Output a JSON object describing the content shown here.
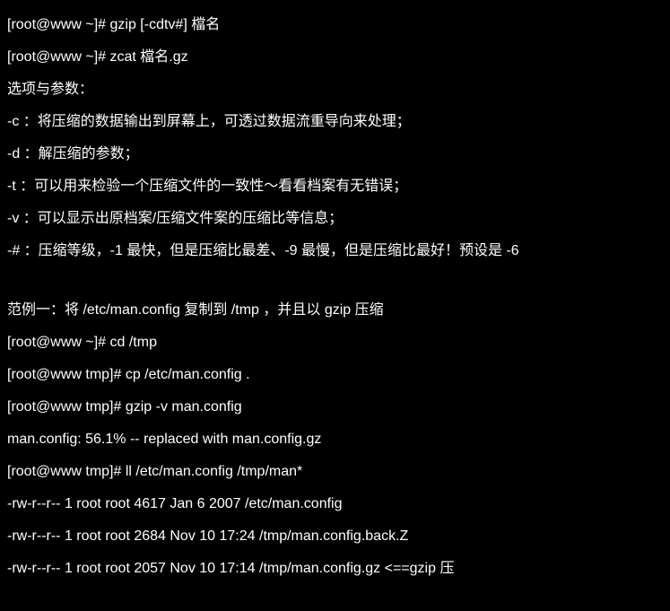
{
  "lines": [
    "[root@www ~]# gzip [-cdtv#] 檔名",
    "[root@www ~]# zcat 檔名.gz",
    "选项与参数：",
    "-c  ：将压缩的数据输出到屏幕上，可透过数据流重导向来处理；",
    "-d  ：解压缩的参数；",
    "-t  ：可以用来检验一个压缩文件的一致性～看看档案有无错误；",
    "-v  ：可以显示出原档案/压缩文件案的压缩比等信息；",
    "-#  ：压缩等级，-1 最快，但是压缩比最差、-9 最慢，但是压缩比最好！预设是 -6",
    "",
    "范例一：将 /etc/man.config 复制到 /tmp ，并且以 gzip 压缩",
    "[root@www ~]# cd /tmp",
    "[root@www tmp]# cp /etc/man.config .",
    "[root@www tmp]# gzip -v man.config",
    "man.config:      56.1% -- replaced with man.config.gz",
    "[root@www tmp]# ll /etc/man.config /tmp/man*",
    "-rw-r--r-- 1 root root 4617 Jan  6  2007 /etc/man.config",
    "-rw-r--r-- 1 root root 2684 Nov 10 17:24 /tmp/man.config.back.Z",
    "-rw-r--r-- 1 root root 2057 Nov 10 17:14 /tmp/man.config.gz  <==gzip 压"
  ]
}
